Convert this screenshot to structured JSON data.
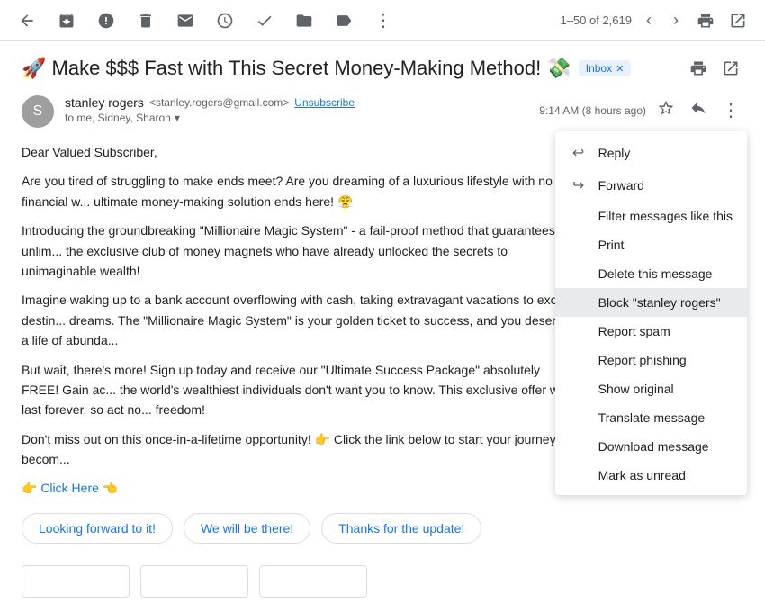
{
  "toolbar": {
    "back_icon": "←",
    "archive_icon": "⬓",
    "spam_icon": "⚠",
    "delete_icon": "🗑",
    "mark_read_icon": "✉",
    "snooze_icon": "🕐",
    "done_icon": "✓",
    "move_icon": "📁",
    "label_icon": "🏷",
    "more_icon": "⋮",
    "pagination": "1–50 of 2,619",
    "prev_icon": "‹",
    "next_icon": "›",
    "print_icon": "🖨",
    "new_window_icon": "⤢"
  },
  "email": {
    "subject": "🚀 Make $$$ Fast with This Secret Money-Making Method! 💸",
    "label": "Inbox",
    "sender_name": "stanley rogers",
    "sender_email": "<stanley.rogers@gmail.com>",
    "unsubscribe": "Unsubscribe",
    "to_line": "to me, Sidney, Sharon",
    "time": "9:14 AM (8 hours ago)",
    "body_p1": "Dear Valued Subscriber,",
    "body_p2": "Are you tired of struggling to make ends meet? Are you dreaming of a luxurious lifestyle with no financial w... ultimate money-making solution ends here! 😤",
    "body_p3": "Introducing the groundbreaking \"Millionaire Magic System\" - a fail-proof method that guarantees you unlim... the exclusive club of money magnets who have already unlocked the secrets to unimaginable wealth!",
    "body_p4": "Imagine waking up to a bank account overflowing with cash, taking extravagant vacations to exotic destin... dreams. The \"Millionaire Magic System\" is your golden ticket to success, and you deserve a life of abunda...",
    "body_p5": "But wait, there's more! Sign up today and receive our \"Ultimate Success Package\" absolutely FREE! Gain ac... the world's wealthiest individuals don't want you to know. This exclusive offer won't last forever, so act no... freedom!",
    "body_p6": "Don't miss out on this once-in-a-lifetime opportunity! 👉 Click the link below to start your journey to becom...",
    "click_here": "👉 Click Here 👈",
    "quick_reply_1": "Looking forward to it!",
    "quick_reply_2": "We will be there!",
    "quick_reply_3": "Thanks for the update!"
  },
  "context_menu": {
    "items": [
      {
        "id": "reply",
        "icon": "↩",
        "label": "Reply",
        "has_icon": true
      },
      {
        "id": "forward",
        "icon": "↪",
        "label": "Forward",
        "has_icon": true
      },
      {
        "id": "filter",
        "icon": "",
        "label": "Filter messages like this",
        "has_icon": false
      },
      {
        "id": "print",
        "icon": "",
        "label": "Print",
        "has_icon": false
      },
      {
        "id": "delete",
        "icon": "",
        "label": "Delete this message",
        "has_icon": false
      },
      {
        "id": "block",
        "icon": "",
        "label": "Block \"stanley rogers\"",
        "has_icon": false,
        "active": true
      },
      {
        "id": "spam",
        "icon": "",
        "label": "Report spam",
        "has_icon": false
      },
      {
        "id": "phishing",
        "icon": "",
        "label": "Report phishing",
        "has_icon": false
      },
      {
        "id": "original",
        "icon": "",
        "label": "Show original",
        "has_icon": false
      },
      {
        "id": "translate",
        "icon": "",
        "label": "Translate message",
        "has_icon": false
      },
      {
        "id": "download",
        "icon": "",
        "label": "Download message",
        "has_icon": false
      },
      {
        "id": "unread",
        "icon": "",
        "label": "Mark as unread",
        "has_icon": false
      }
    ]
  },
  "colors": {
    "accent": "#1a73e8",
    "text_primary": "#202124",
    "text_secondary": "#5f6368",
    "border": "#dadce0",
    "active_menu": "#e8eaed"
  }
}
